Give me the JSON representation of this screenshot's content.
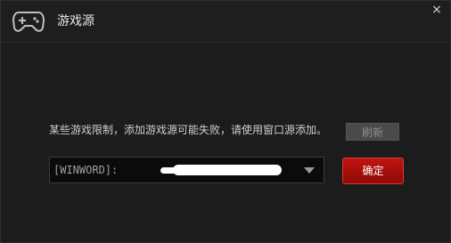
{
  "window": {
    "title": "游戏源",
    "close_label": "×"
  },
  "dialog": {
    "notice": "某些游戏限制，添加游戏源可能失败，请使用窗口源添加。",
    "refresh_label": "刷新",
    "source_select": {
      "selected_value": "[WINWORD]:"
    },
    "confirm_label": "确定"
  },
  "icons": {
    "title_icon": "gamepad-icon",
    "close_icon": "close-icon",
    "dropdown_icon": "chevron-down-icon"
  },
  "colors": {
    "confirm_button": "#b3120c",
    "background": "#1c1c1c"
  }
}
